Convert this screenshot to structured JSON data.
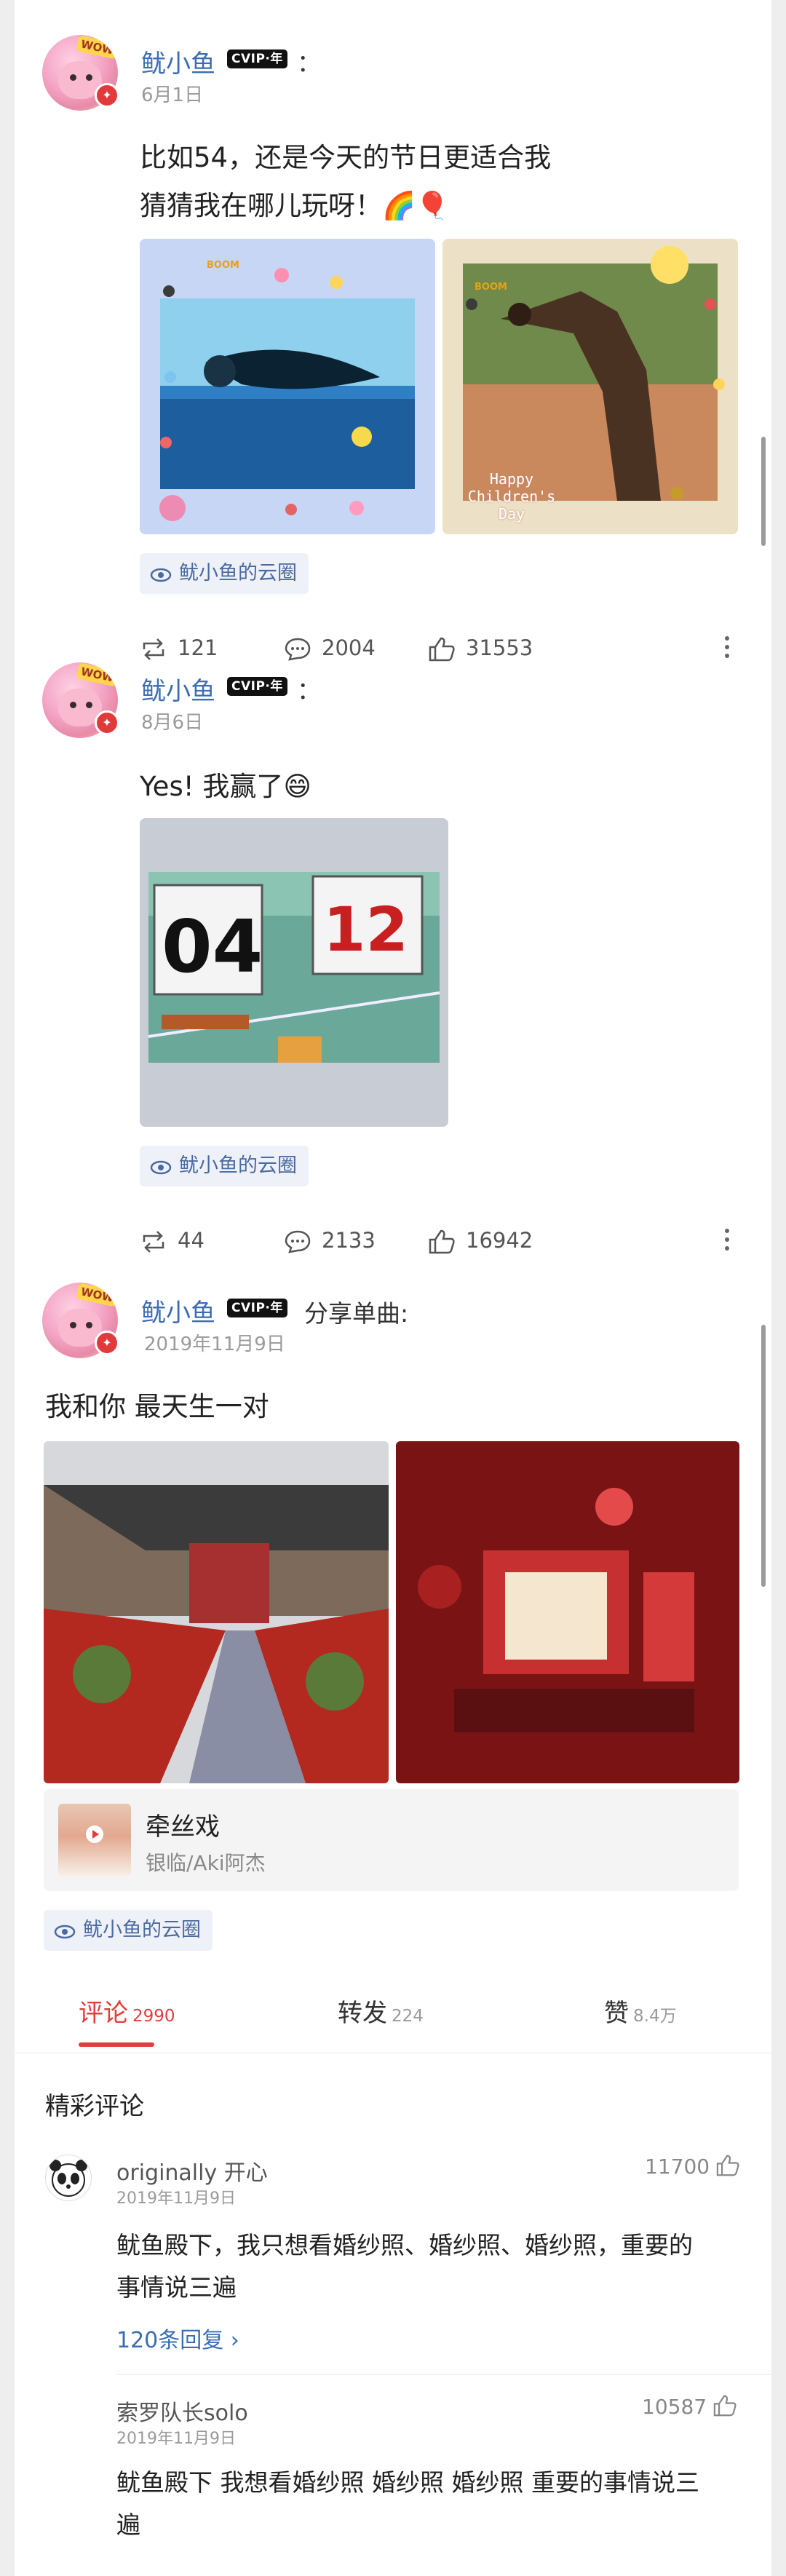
{
  "posts": [
    {
      "author": "鱿小鱼",
      "vip_badge": "CVIP·年",
      "after_name": "：",
      "date": "6月1日",
      "text_lines": [
        "比如54，还是今天的节日更适合我",
        "猜猜我在哪儿玩呀！🌈🎈"
      ],
      "image_captions": [
        "",
        "Happy Children's Day"
      ],
      "circle": "鱿小鱼的云圈",
      "reposts": "121",
      "comments": "2004",
      "likes": "31553"
    },
    {
      "author": "鱿小鱼",
      "vip_badge": "CVIP·年",
      "after_name": "：",
      "date": "8月6日",
      "text_lines": [
        "Yes! 我赢了😄"
      ],
      "score_left": "04",
      "score_right": "12",
      "circle": "鱿小鱼的云圈",
      "reposts": "44",
      "comments": "2133",
      "likes": "16942"
    },
    {
      "author": "鱿小鱼",
      "vip_badge": "CVIP·年",
      "after_name": "分享单曲:",
      "date": "2019年11月9日",
      "text_lines": [
        "我和你 最天生一对"
      ],
      "song": {
        "title": "牵丝戏",
        "artist": "银临/Aki阿杰"
      },
      "circle": "鱿小鱼的云圈"
    }
  ],
  "tabs": [
    {
      "label": "评论",
      "count": "2990",
      "active": true
    },
    {
      "label": "转发",
      "count": "224",
      "active": false
    },
    {
      "label": "赞",
      "count": "8.4万",
      "active": false
    }
  ],
  "section_title": "精彩评论",
  "comments": [
    {
      "name": "originally 开心",
      "date": "2019年11月9日",
      "likes": "11700",
      "text_lines": [
        "鱿鱼殿下，我只想看婚纱照、婚纱照、婚纱照，重要的",
        "事情说三遍"
      ],
      "replies": "120条回复 ›"
    },
    {
      "name": "索罗队长solo",
      "date": "2019年11月9日",
      "likes": "10587",
      "text_lines": [
        "鱿鱼殿下 我想看婚纱照 婚纱照 婚纱照 重要的事情说三",
        "遍"
      ]
    }
  ],
  "colors": {
    "accent": "#e23d3d",
    "link": "#3b6db5",
    "vip_bg": "#111111"
  }
}
